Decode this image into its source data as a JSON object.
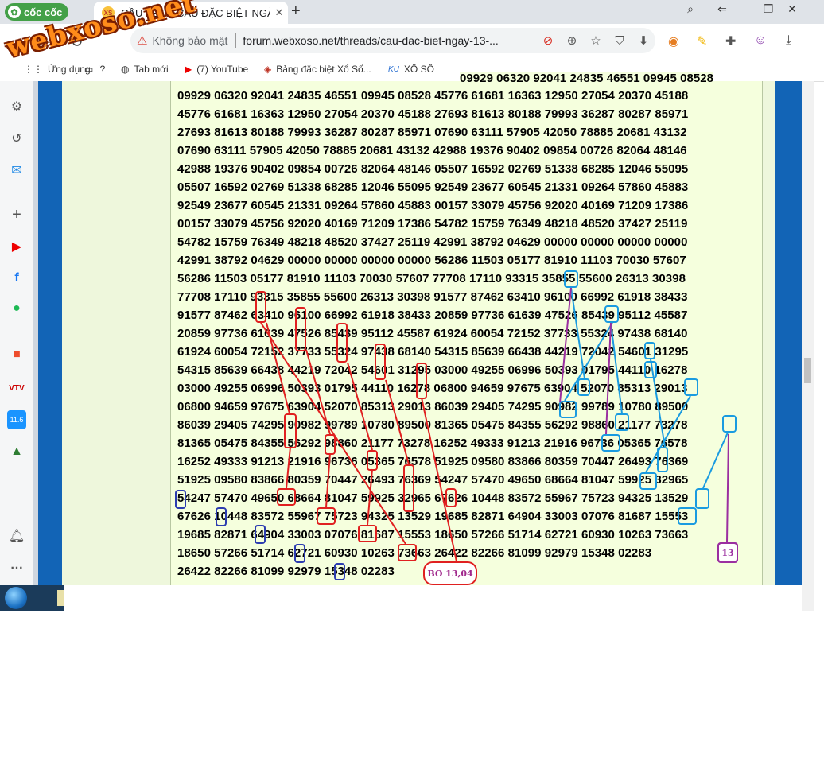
{
  "browser": {
    "brand": "cốc cốc",
    "tab_title": "CẦU KÈO - CẦU ĐẶC BIỆT NGÀY",
    "tab_favicon_text": "XS",
    "insecure_label": "Không bảo mật",
    "url": "forum.webxoso.net/threads/cau-dac-biet-ngay-13-...",
    "watermark": "webxoso.net"
  },
  "bookmarks": [
    {
      "label": "Ứng dụng",
      "icon": "apps-icon"
    },
    {
      "label": "'?",
      "icon": "folder-icon"
    },
    {
      "label": "Tab mới",
      "icon": "globe-icon"
    },
    {
      "label": "(7) YouTube",
      "icon": "youtube-icon"
    },
    {
      "label": "Bảng đặc biệt Xổ Số...",
      "icon": "lottery-icon"
    },
    {
      "label": "XỔ SỐ",
      "icon": "ku-icon"
    }
  ],
  "sidebar_apps": [
    "settings-icon",
    "history-icon",
    "messenger-icon",
    "add-icon",
    "youtube-icon",
    "facebook-icon",
    "spotify-icon",
    "shopee-icon",
    "vtv-go-icon",
    "tiki-icon",
    "education-icon",
    "notification-icon",
    "more-icon"
  ],
  "sidebar_badges": {
    "tiki": "11.6"
  },
  "board": {
    "top_row": "09929 06320 92041 24835 46551 09945 08528",
    "rows": [
      "09929 06320 92041 24835 46551 09945 08528 45776 61681 16363 12950 27054 20370 45188",
      "45776 61681 16363 12950 27054 20370 45188 27693 81613 80188 79993 36287 80287 85971",
      "27693 81613 80188 79993 36287 80287 85971 07690 63111 57905 42050 78885 20681 43132",
      "07690 63111 57905 42050 78885 20681 43132 42988 19376 90402 09854 00726 82064 48146",
      "42988 19376 90402 09854 00726 82064 48146 05507 16592 02769 51338 68285 12046 55095",
      "05507 16592 02769 51338 68285 12046 55095 92549 23677 60545 21331 09264 57860 45883",
      "92549 23677 60545 21331 09264 57860 45883 00157 33079 45756 92020 40169 71209 17386",
      "00157 33079 45756 92020 40169 71209 17386 54782 15759 76349 48218 48520 37427 25119",
      "54782 15759 76349 48218 48520 37427 25119 42991 38792 04629 00000 00000 00000 00000",
      "42991 38792 04629 00000 00000 00000 00000 56286 11503 05177 81910 11103 70030 57607",
      "56286 11503 05177 81910 11103 70030 57607 77708 17110 93315 35855 55600 26313 30398",
      "77708 17110 93315 35855 55600 26313 30398 91577 87462 63410 96100 66992 61918 38433",
      "91577 87462 63410 96100 66992 61918 38433 20859 97736 61639 47526 85439 95112 45587",
      "20859 97736 61639 47526 85439 95112 45587 61924 60054 72152 37733 55324 97438 68140",
      "61924 60054 72152 37733 55324 97438 68140 54315 85639 66438 44219 72042 54601 31295",
      "54315 85639 66438 44219 72042 54601 31295 03000 49255 06996 50393 01795 44110 16278",
      "03000 49255 06996 50393 01795 44110 16278 06800 94659 97675 63904 52070 85313 29013",
      "06800 94659 97675 63904 52070 85313 29013 86039 29405 74295 90982 99789 10780 89500",
      "86039 29405 74295 90982 99789 10780 89500 81365 05475 84355 56292 98860 21177 73278",
      "81365 05475 84355 56292 98860 21177 73278 16252 49333 91213 21916 96736 05365 76578",
      "16252 49333 91213 21916 96736 05365 76578 51925 09580 83866 80359 70447 26493 76369",
      "51925 09580 83866 80359 70447 26493 76369 54247 57470 49650 68664 81047 59925 32965",
      "54247 57470 49650 68664 81047 59925 32965 67626 10448 83572 55967 75723 94325 13529",
      "67626 10448 83572 55967 75723 94325 13529 19685 82871 64904 33003 07076 81687 15553",
      "19685 82871 64904 33003 07076 81687 15553 18650 57266 51714 62721 60930 10263 73663",
      "18650 57266 51714 62721 60930 10263 73663 26422 82266 81099 92979 15348 02283",
      "26422 82266 81099 92979 15348 02283"
    ]
  },
  "annotations": {
    "bo_label": "BO 13,04",
    "purple_label": "13",
    "colors": {
      "red": "#e02020",
      "cyan": "#1a9be0",
      "navy": "#2c3cb0",
      "purple": "#9b2fa0"
    }
  }
}
